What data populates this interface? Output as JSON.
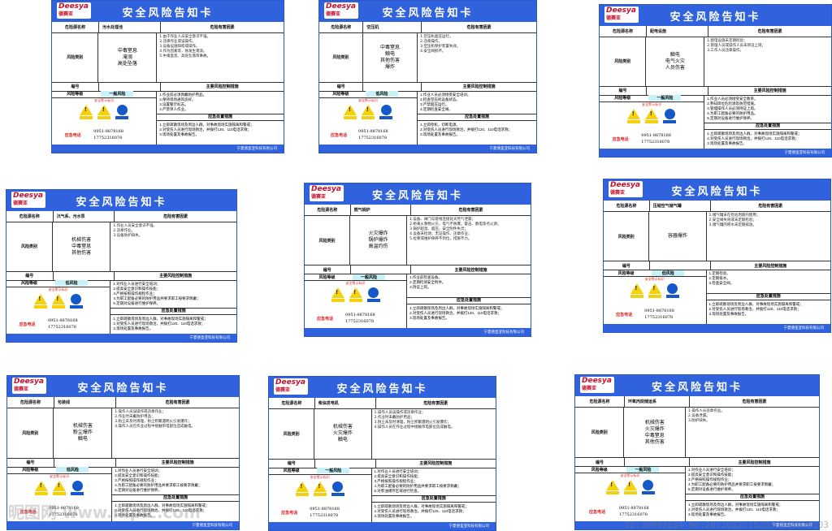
{
  "common": {
    "logo": "Deesya",
    "logo_sub": "德赛亚",
    "title": "安全风险告知卡",
    "hazard_name_label": "危险源名称",
    "hazard_factor_label": "危险有害因素",
    "risk_type_label": "风险类别",
    "number_label": "编号",
    "control_label": "主要风险控制措施",
    "level_label": "风险等级",
    "warning_sign_label": "安全警示标识",
    "emergency_measures_label": "应急处置措施",
    "emergency_phone_label": "应急电话",
    "phones": [
      "0951-8878168",
      "17752316078"
    ],
    "footer": "宁夏德圣亚科技有限公司"
  },
  "cards": [
    {
      "hazard": "污水处理池",
      "risks": [
        "中毒窒息",
        "淹溺",
        "高处坠落"
      ],
      "level": "一般风险",
      "factors": [
        "1.由于作业人员安全意识不强。",
        "2.违章作业或误操作。",
        "3.设备设施缺陷或操作。",
        "4.作为因素等，易发生淹溺。",
        "5.中毒窒息、高处坠落等事故。"
      ],
      "controls": [
        "1.作业前必须佩戴防护用品。",
        "2.保持现场通风良好。",
        "3.设置警示标志。",
        "4.严禁单人作业。"
      ],
      "emergency": [
        "1.立即疏散现场及周边人群，对事故现场实施隔离和警戒；",
        "2.对受伤人员进行现场救治，并拨打120、110电话求救；",
        "3.现场处置及事故报告。"
      ]
    },
    {
      "hazard": "空压机",
      "risks": [
        "中毒窒息",
        "触电",
        "其他伤害",
        "爆炸"
      ],
      "level": "低风险",
      "factors": [
        "1.空压机超压运行。",
        "2.违章操作。",
        "3.空压机保护装置失效。",
        "4.安全阀损坏。"
      ],
      "controls": [
        "1.作业人员必须接受安全培训。",
        "2.检查空压机设备状态。",
        "3.严禁超压运行。",
        "4.定期检查安全阀。"
      ],
      "emergency": [
        "1.立即停机，切断电源。",
        "2.对受伤人员进行现场救治，并拨打120、110电话求救；",
        "3.现场处置及事故报告。"
      ]
    },
    {
      "hazard": "配电设施",
      "risks": [
        "触电",
        "电气火灾",
        "人员伤害"
      ],
      "level": "一般风险",
      "factors": [
        "1.配电设施未定期检验；",
        "2.管理人员或操作人员未持证上岗；",
        "3.工作人员违章操作。"
      ],
      "controls": [
        "1.作业人员必须接受安全教育。",
        "2.熟知岗位危险源及防范措施。",
        "3.管理操作人员必须持证上岗。",
        "4.为职工配备必要的防护用品。",
        "5.定期对设备进行维护保养。"
      ],
      "emergency": [
        "1.立即疏散现场及周边人群，对事故现场实施隔离和警戒；",
        "2.对受伤人员进行现场救治，并拨打120、110电话求救；",
        "3.现场处置及事故报告。"
      ]
    },
    {
      "hazard": "沉气系、污水泵",
      "risks": [
        "机械伤害",
        "中毒窒息",
        "其他伤害"
      ],
      "level": "低风险",
      "factors": [
        "1.作业人员安全意识不强。",
        "2.违章作业。",
        "3.设备防护缺失。"
      ],
      "controls": [
        "1.对作业人员进行安全培训；",
        "2.提高安全意识和操作技能；",
        "3.严格按照操作规程作业；",
        "4.为职工配备必要的防护用品并要求职工按要求佩戴；",
        "5.定期对设备进行维护保养。"
      ],
      "emergency": [
        "1.立即疏散现场及周边人群，对事故现场实施隔离和警戒；",
        "2.对受伤人员进行现场救治，并拨打120、110电话求救；",
        "3.现场处置及事故报告。"
      ]
    },
    {
      "hazard": "燃气锅炉",
      "risks": [
        "火灾爆炸",
        "锅炉爆炸",
        "高温灼伤"
      ],
      "level": "一般风险",
      "factors": [
        "1.设备、阀门与管线连接处天然气泄漏；",
        "2.桥来火救物火灾，电气不防爆，雷击、静电等点火源；",
        "3.锅炉超温、超压，安全附件失灵；",
        "4.设备未检测；无证操作、违章作业；",
        "5.拉巷或维护保养不到位，措施不力。"
      ],
      "controls": [
        "1.作业前检查设备。",
        "2.定期检测安全附件。",
        "3.持证上岗。"
      ],
      "emergency": [
        "1.立即疏散现场及周边人群，对事故现场实施隔离和警戒；",
        "2.对受伤人员进行现场救治，并拨打120、110电话求救；",
        "3.现场处置及事故报告。"
      ]
    },
    {
      "hazard": "压缩空气储气罐",
      "risks": [
        "容器爆炸"
      ],
      "level": "低风险",
      "factors": [
        "1.储气罐未在检验周期内使用；",
        "2.安全阀失效或未定期检验；",
        "3.储气罐内积水未定期排放。"
      ],
      "controls": [
        "1.定期检验。",
        "2.定期排水。",
        "3.检查安全阀。"
      ],
      "emergency": [
        "1.立即疏散现场及周边人群，对事故现场实施隔离和警戒；",
        "2.对受伤人员进行现场救治，并拨打120、110电话求救；",
        "3.现场处置及事故报告。"
      ]
    },
    {
      "hazard": "包装线",
      "risks": [
        "机械伤害",
        "粉尘爆炸",
        "触电"
      ],
      "level": "低风险",
      "factors": [
        "1.操作人员误操作或违章作业；",
        "2.作业时未戴防护用品；",
        "3.粉尘未及时清理，粉尘积聚遇明火引发爆炸；",
        "4.操作人员在作业过程中接触带电部位造成触电。"
      ],
      "controls": [
        "1.对作业人员进行安全培训；",
        "2.提高安全意识和操作技能；",
        "3.严格按照操作规程作业；",
        "4.为职工配备必要的防护用品并要求职工按要求佩戴；",
        "5.定期对设备进行维护保养。"
      ],
      "emergency": [
        "1.立即疏散现场及周边人群，对事故现场实施隔离和警戒；",
        "2.对受伤人员进行现场救治，并拨打120、110电话求救；",
        "3.现场处置及事故报告。"
      ]
    },
    {
      "hazard": "柴油发电机",
      "risks": [
        "机械伤害",
        "火灾爆炸",
        "触电"
      ],
      "level": "一般风险",
      "factors": [
        "1.操作人员误操作或违章作业；",
        "2.作业时未戴防护用品；",
        "3.粉尘未及时清理，粉尘积聚遇明火引发爆炸；",
        "4.操作人员在作业过程中接触带电部位造成触电。"
      ],
      "controls": [
        "1.对作业人员进行安全培训；",
        "2.提高安全意识和操作技能；",
        "3.严格按照操作规程作业；",
        "4.为职工配备必要的防护用品并要求职工按要求佩戴；",
        "5.对柴油储存区域进行检查。"
      ],
      "emergency": [
        "1.立即疏散现场及周边人群，对事故现场实施隔离和警戒；",
        "2.对受伤人员进行现场救治，并拨打120、110电话求救；",
        "3.现场处置及事故报告。"
      ]
    },
    {
      "hazard": "环氧丙烷储运系",
      "risks": [
        "机械伤害",
        "火灾爆炸",
        "中毒窒息",
        "其他伤害"
      ],
      "level": "一般风险",
      "factors": [
        "1.操作人员违章作业。",
        "2.设备泄漏。",
        "3.防护缺失。"
      ],
      "controls": [
        "1.对作业人员进行安全培训；",
        "2.提高安全意识和操作技能；",
        "3.严格按照操作规程作业；",
        "4.为职工配备必要的防护用品并要求职工按要求佩戴；",
        "5.定期对设备进行维护保养。"
      ],
      "emergency": [
        "1.立即疏散现场及周边人群，对事故现场实施隔离和警戒；",
        "2.对受伤人员进行现场救治，并拨打120、110电话求救；",
        "3.现场处置及事故报告。"
      ]
    }
  ],
  "watermark": "昵图网 www.nipic.com",
  "image_id": "ID:30002634 NO:20220525152833848518103"
}
